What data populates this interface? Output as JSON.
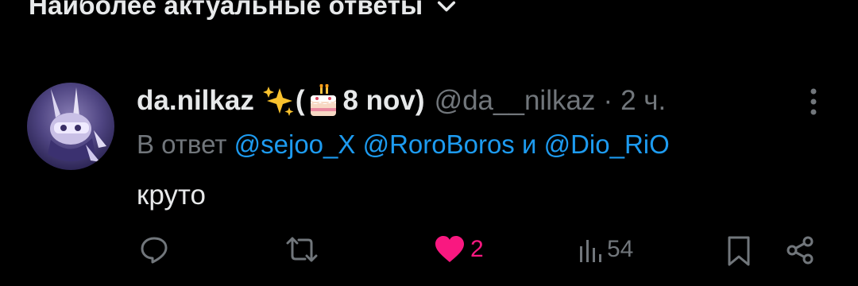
{
  "header": {
    "sort_label": "Наиболее актуальные ответы"
  },
  "tweet": {
    "display_name": "da.nilkaz",
    "name_suffix_open": "(",
    "name_suffix_date": "8 nov)",
    "handle": "@da__nilkaz",
    "separator": "·",
    "time": "2 ч.",
    "reply_prefix": "В ответ",
    "mentions": [
      "@sejoo_X",
      "@RoroBoros"
    ],
    "reply_and": "и",
    "mention_last": "@Dio_RiO",
    "text": "круто",
    "actions": {
      "likes": "2",
      "views": "54"
    }
  },
  "colors": {
    "background": "#000000",
    "primary_text": "#e7e9ea",
    "secondary_text": "#71767b",
    "link": "#1d9bf0",
    "like": "#f91880"
  },
  "icons": [
    "chevron-down-icon",
    "sparkles-emoji",
    "birthday-cake-emoji",
    "more-vertical-icon",
    "reply-icon",
    "retweet-icon",
    "heart-icon",
    "views-icon",
    "bookmark-icon",
    "share-icon"
  ]
}
